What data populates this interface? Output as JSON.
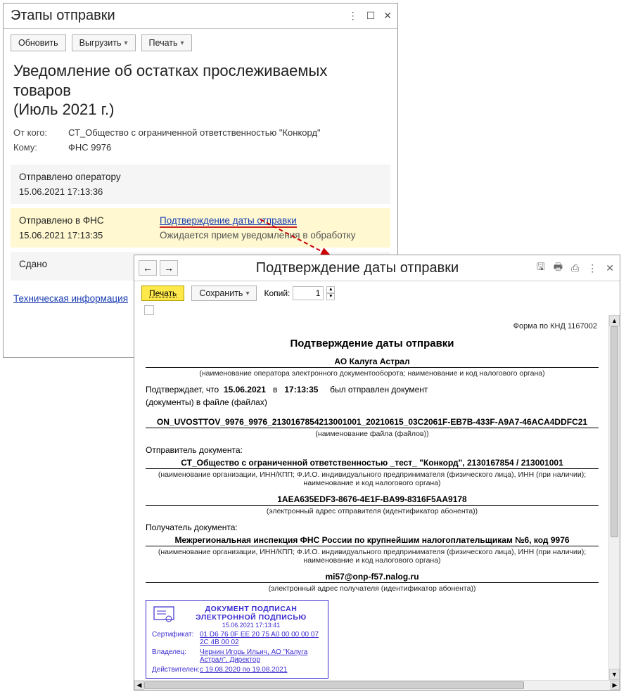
{
  "win1": {
    "title": "Этапы отправки",
    "toolbar": {
      "refresh": "Обновить",
      "export": "Выгрузить",
      "print": "Печать"
    },
    "doc_title_line1": "Уведомление об остатках прослеживаемых товаров",
    "doc_title_line2": "(Июль 2021 г.)",
    "from_label": "От кого:",
    "from_value": "СТ_Общество с ограниченной ответственностью \"Конкорд\"",
    "to_label": "Кому:",
    "to_value": "ФНС 9976",
    "stage1": {
      "name": "Отправлено оператору",
      "time": "15.06.2021 17:13:36"
    },
    "stage2": {
      "name": "Отправлено в ФНС",
      "time": "15.06.2021 17:13:35",
      "link": "Подтверждение даты отправки",
      "sub": "Ожидается прием уведомления в обработку"
    },
    "stage3": {
      "name": "Сдано"
    },
    "tech_link": "Техническая информация"
  },
  "win2": {
    "title": "Подтверждение даты отправки",
    "toolbar": {
      "print": "Печать",
      "save": "Сохранить",
      "copies_label": "Копий:",
      "copies_value": "1"
    },
    "knd": "Форма по КНД 1167002",
    "doc": {
      "heading": "Подтверждение даты отправки",
      "operator": "АО Калуга Астрал",
      "operator_caption": "(наименование оператора электронного документооборота; наименование и код налогового органа)",
      "confirms_pre": "Подтверждает, что",
      "confirms_date": "15.06.2021",
      "confirms_at": "в",
      "confirms_time": "17:13:35",
      "confirms_post": "был отправлен документ",
      "files_line": "(документы) в файле (файлах)",
      "filename": "ON_UVOSTTOV_9976_9976_2130167854213001001_20210615_03C2061F-EB7B-433F-A9A7-46ACA4DDFC21",
      "filename_caption": "(наименование файла (файлов))",
      "sender_label": "Отправитель документа:",
      "sender": "СТ_Общество с ограниченной ответственностью _тест_ \"Конкорд\", 2130167854 / 213001001",
      "org_caption": "(наименование организации, ИНН/КПП; Ф.И.О. индивидуального предпринимателя (физического лица), ИНН (при наличии); наименование и код налогового органа)",
      "sender_addr": "1AEA635EDF3-8676-4E1F-BA99-8316F5AA9178",
      "sender_addr_caption": "(электронный адрес отправителя (идентификатор абонента))",
      "recipient_label": "Получатель документа:",
      "recipient": "Межрегиональная инспекция ФНС России по крупнейшим налогоплательщикам №6, код 9976",
      "recipient_addr": "mi57@onp-f57.nalog.ru",
      "recipient_addr_caption": "(электронный адрес получателя (идентификатор абонента))"
    },
    "stamp": {
      "title1": "ДОКУМЕНТ ПОДПИСАН",
      "title2": "ЭЛЕКТРОННОЙ ПОДПИСЬЮ",
      "date": "15.06.2021 17:13:41",
      "cert_label": "Сертификат:",
      "cert": "01 D6 76 0F EE 20 75 A0 00 00 00 07 2C 4B 00 02",
      "owner_label": "Владелец:",
      "owner": "Чернин Игорь Ильич, АО \"Калуга Астрал\", Директор",
      "valid_label": "Действителен:",
      "valid": "с 19.08.2020 по 19.08.2021"
    }
  },
  "chart_data": {
    "type": "table",
    "note": "no chart in image"
  }
}
